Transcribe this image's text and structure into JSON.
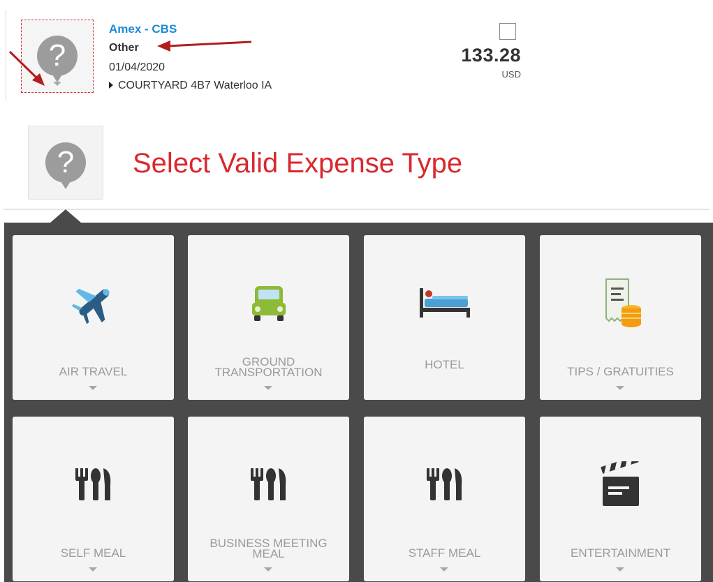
{
  "expense": {
    "payment_type": "Amex - CBS",
    "expense_type": "Other",
    "date": "01/04/2020",
    "merchant": "COURTYARD 4B7 Waterloo IA",
    "amount": "133.28",
    "currency": "USD",
    "type_icon": "question-icon"
  },
  "selector": {
    "title": "Select Valid Expense Type",
    "icon": "question-icon"
  },
  "expense_types": [
    {
      "label": "AIR TRAVEL",
      "icon": "airplane-icon"
    },
    {
      "label": "GROUND TRANSPORTATION",
      "label_lines": [
        "GROUND",
        "TRANSPORTATION"
      ],
      "icon": "car-icon"
    },
    {
      "label": "HOTEL",
      "icon": "bed-icon"
    },
    {
      "label": "TIPS / GRATUITIES",
      "icon": "receipt-coins-icon"
    },
    {
      "label": "SELF MEAL",
      "icon": "utensils-icon"
    },
    {
      "label": "BUSINESS MEETING MEAL",
      "label_lines": [
        "BUSINESS MEETING",
        "MEAL"
      ],
      "icon": "utensils-icon"
    },
    {
      "label": "STAFF MEAL",
      "icon": "utensils-icon"
    },
    {
      "label": "ENTERTAINMENT",
      "icon": "clapperboard-icon"
    }
  ],
  "colors": {
    "accent_red": "#d9282f",
    "link_blue": "#1a8bd6",
    "panel_bg": "#4a4a4a",
    "tile_bg": "#f4f4f4"
  }
}
